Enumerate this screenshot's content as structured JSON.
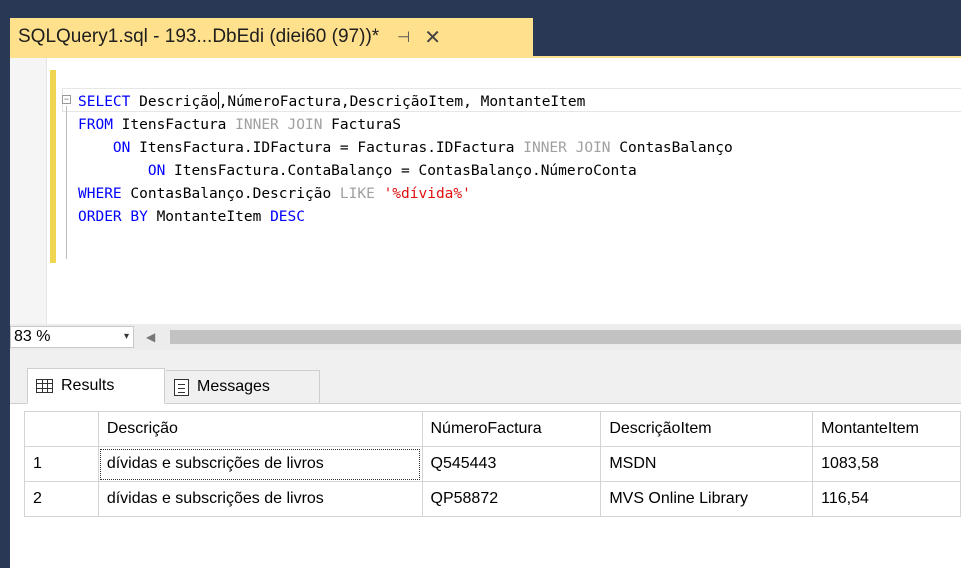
{
  "window": {
    "tab_title": "SQLQuery1.sql - 193...DbEdi (diei60 (97))*",
    "pin_glyph": "⊣",
    "close_glyph": "✕"
  },
  "editor": {
    "lines": [
      [
        {
          "t": "SELECT",
          "c": "kw"
        },
        {
          "t": " Descrição"
        },
        {
          "caret": true
        },
        {
          "t": ",NúmeroFactura,DescriçãoItem, MontanteItem"
        }
      ],
      [
        {
          "t": "FROM",
          "c": "kw"
        },
        {
          "t": " ItensFactura "
        },
        {
          "t": "INNER JOIN",
          "c": "kg"
        },
        {
          "t": " FacturaS"
        }
      ],
      [
        {
          "t": "    "
        },
        {
          "t": "ON",
          "c": "kw"
        },
        {
          "t": " ItensFactura.IDFactura = Facturas.IDFactura "
        },
        {
          "t": "INNER JOIN",
          "c": "kg"
        },
        {
          "t": " ContasBalanço"
        }
      ],
      [
        {
          "t": "        "
        },
        {
          "t": "ON",
          "c": "kw"
        },
        {
          "t": " ItensFactura.ContaBalanço = ContasBalanço.NúmeroConta"
        }
      ],
      [
        {
          "t": "WHERE",
          "c": "kw"
        },
        {
          "t": " ContasBalanço.Descrição "
        },
        {
          "t": "LIKE",
          "c": "kg"
        },
        {
          "t": " "
        },
        {
          "t": "'%dívida%'",
          "c": "str"
        }
      ],
      [
        {
          "t": "ORDER BY",
          "c": "kw"
        },
        {
          "t": " MontanteItem "
        },
        {
          "t": "DESC",
          "c": "kw"
        }
      ]
    ]
  },
  "zoom": {
    "value": "83 %",
    "dropdown_glyph": "▾",
    "scroll_left_glyph": "◀"
  },
  "results": {
    "tabs": {
      "results_label": "Results",
      "messages_label": "Messages"
    },
    "columns": [
      "",
      "Descrição",
      "NúmeroFactura",
      "DescriçãoItem",
      "MontanteItem"
    ],
    "rows": [
      [
        "1",
        "dívidas e subscrições de livros",
        "Q545443",
        "MSDN",
        "1083,58"
      ],
      [
        "2",
        "dívidas e subscrições de livros",
        "QP58872",
        "MVS Online Library",
        "116,54"
      ]
    ]
  },
  "colors": {
    "chrome_dark": "#293955",
    "tab_active": "#ffe08c",
    "keyword": "#0000ff",
    "keyword_gray": "#a0a0a0",
    "string": "#e01010"
  }
}
